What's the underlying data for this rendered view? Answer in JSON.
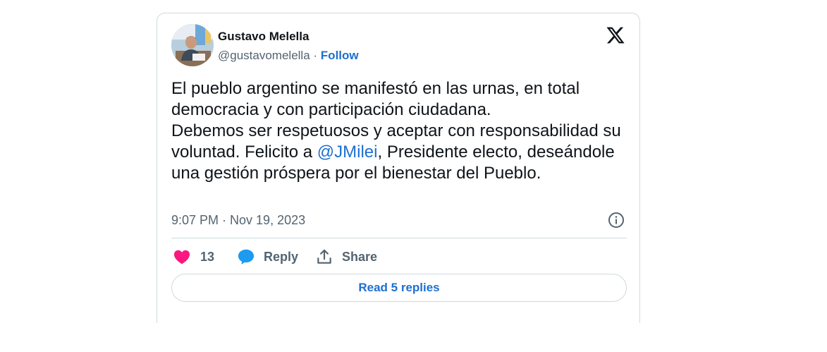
{
  "author": {
    "name": "Gustavo Melella",
    "handle": "@gustavomelella",
    "separator": "·",
    "follow_label": "Follow"
  },
  "tweet": {
    "text_part1": "El pueblo argentino se manifestó en las urnas, en total democracia y con participación ciudadana.\nDebemos ser respetuosos y aceptar con responsabilidad su voluntad. Felicito a ",
    "mention": "@JMilei",
    "text_part2": ", Presidente electo, deseándole una gestión próspera por el bienestar del Pueblo.",
    "timestamp": "9:07 PM · Nov 19, 2023"
  },
  "actions": {
    "like_count": "13",
    "reply_label": "Reply",
    "share_label": "Share"
  },
  "read_replies_label": "Read 5 replies",
  "icons": {
    "logo": "x-logo-icon",
    "info": "info-icon",
    "like": "heart-icon",
    "reply": "speech-bubble-icon",
    "share": "share-upload-icon"
  },
  "colors": {
    "like": "#f91880",
    "link": "#1d6fd0",
    "reply_bubble": "#1d9bf0",
    "muted_text": "#536471",
    "border": "#cfd9de"
  }
}
